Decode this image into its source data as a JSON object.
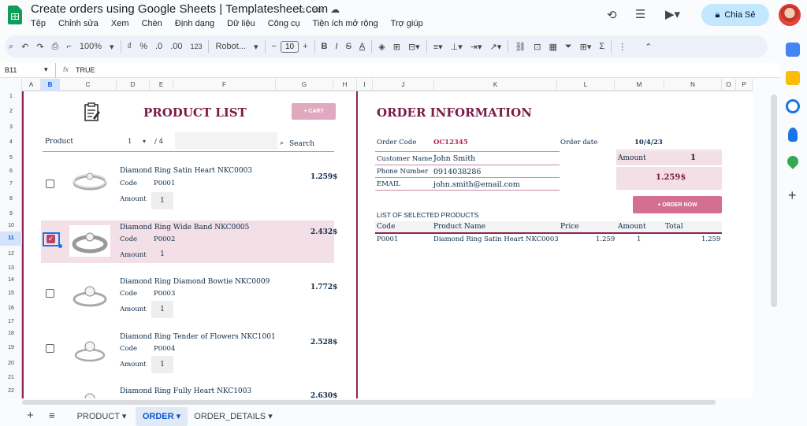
{
  "app": {
    "title": "Create orders using Google Sheets | Templatesheet.com",
    "menu": [
      "Tệp",
      "Chỉnh sửa",
      "Xem",
      "Chèn",
      "Định dạng",
      "Dữ liệu",
      "Công cụ",
      "Tiện ích mở rộng",
      "Trợ giúp"
    ],
    "share_label": "Chia Sẻ"
  },
  "toolbar": {
    "zoom": "100%",
    "percent": "%",
    "decimal_dec": ".0",
    "decimal_inc": ".00",
    "format_123": "123",
    "font": "Robot...",
    "font_size": "10",
    "minus": "−",
    "plus": "+"
  },
  "formula": {
    "cell_ref": "B11",
    "fx": "fx",
    "value": "TRUE"
  },
  "columns": [
    "A",
    "B",
    "C",
    "D",
    "E",
    "F",
    "G",
    "H",
    "I",
    "J",
    "K",
    "L",
    "M",
    "N",
    "O",
    "P"
  ],
  "rows": [
    "1",
    "2",
    "3",
    "4",
    "5",
    "6",
    "7",
    "8",
    "9",
    "10",
    "11",
    "12",
    "13",
    "14",
    "15",
    "16",
    "17",
    "18",
    "19",
    "20",
    "21",
    "22"
  ],
  "product_list": {
    "title": "PRODUCT LIST",
    "cart_button": "+ CART",
    "product_label": "Product",
    "page_current": "1",
    "page_total": "/ 4",
    "search_label": "Search",
    "code_label": "Code",
    "amount_label": "Amount",
    "items": [
      {
        "name": "Diamond Ring Satin Heart NKC0003",
        "code": "P0001",
        "amount": "1",
        "price": "1.259$",
        "selected": false
      },
      {
        "name": "Diamond Ring Wide Band NKC0005",
        "code": "P0002",
        "amount": "1",
        "price": "2.432$",
        "selected": true
      },
      {
        "name": "Diamond Ring Diamond Bowtie NKC0009",
        "code": "P0003",
        "amount": "1",
        "price": "1.772$",
        "selected": false
      },
      {
        "name": "Diamond Ring Tender of Flowers NKC1001",
        "code": "P0004",
        "amount": "1",
        "price": "2.528$",
        "selected": false
      },
      {
        "name": "Diamond Ring Fully Heart NKC1003",
        "code": "",
        "amount": "",
        "price": "2.630$",
        "selected": false
      }
    ]
  },
  "order_info": {
    "title": "ORDER INFORMATION",
    "order_code_label": "Order Code",
    "order_code": "OC12345",
    "order_date_label": "Order date",
    "order_date": "10/4/23",
    "customer_name_label": "Customer Name",
    "customer_name": "John Smith",
    "phone_label": "Phone Number",
    "phone": "0914038286",
    "email_label": "EMAIL",
    "email": "john.smith@email.com",
    "amount_label": "Amount",
    "amount": "1",
    "total": "1.259$",
    "order_now_button": "+ ORDER NOW",
    "selected_title": "LIST OF SELECTED PRODUCTS",
    "headers": [
      "Code",
      "Product Name",
      "Price",
      "Amount",
      "Total"
    ],
    "selected_rows": [
      {
        "code": "P0001",
        "name": "Diamond Ring Satin Heart NKC0003",
        "price": "1.259",
        "amount": "1",
        "total": "1.259"
      }
    ]
  },
  "tabs": [
    {
      "label": "PRODUCT",
      "active": false
    },
    {
      "label": "ORDER",
      "active": true
    },
    {
      "label": "ORDER_DETAILS",
      "active": false
    }
  ],
  "colors": {
    "accent": "#7b1a46",
    "pink": "#e0a9bf",
    "selected_row": "#f3dfe6",
    "share_bg": "#c2e7ff"
  }
}
